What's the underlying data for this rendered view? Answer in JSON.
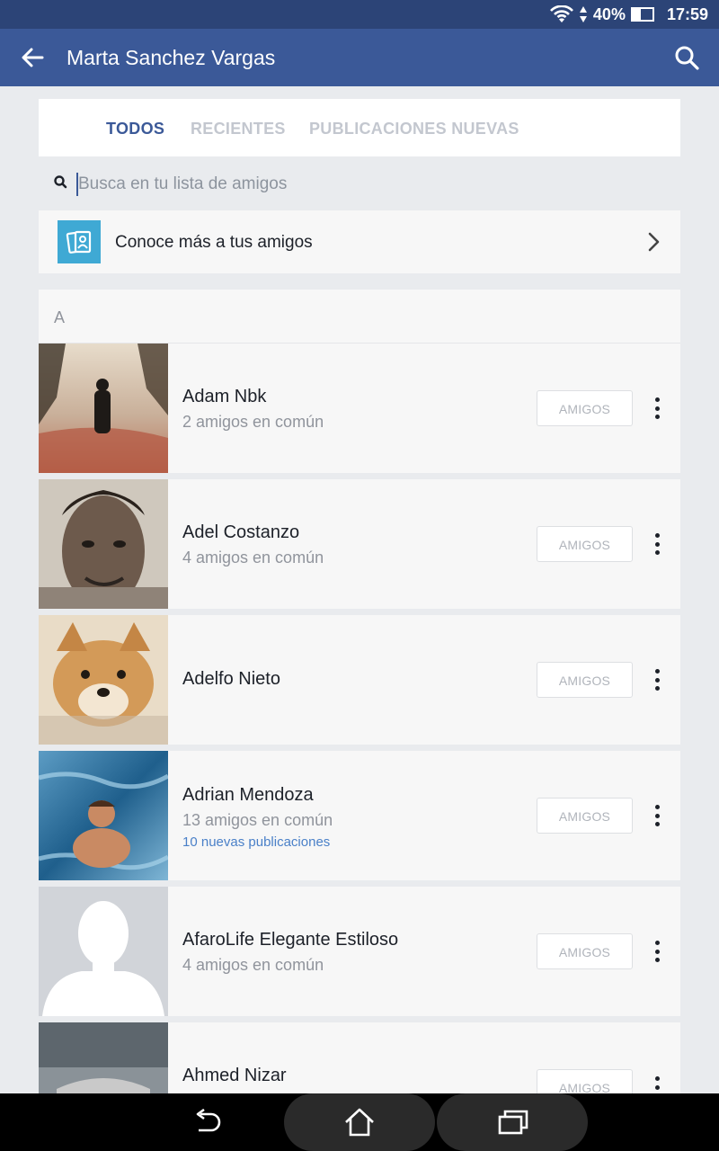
{
  "status_bar": {
    "battery_percent": "40%",
    "time": "17:59",
    "icons": [
      "wifi-icon",
      "data-arrows-icon",
      "battery-icon"
    ]
  },
  "app_bar": {
    "title": "Marta Sanchez Vargas",
    "icons": [
      "back-arrow-icon",
      "search-icon"
    ]
  },
  "tabs": [
    {
      "label": "TODOS",
      "active": true
    },
    {
      "label": "RECIENTES",
      "active": false
    },
    {
      "label": "PUBLICACIONES NUEVAS",
      "active": false
    }
  ],
  "search": {
    "placeholder": "Busca en tu lista de amigos",
    "value": ""
  },
  "discover": {
    "label": "Conoce más a tus amigos",
    "icon": "friends-cards-icon"
  },
  "section": {
    "letter": "A"
  },
  "friends": [
    {
      "name": "Adam Nbk",
      "mutual": "2 amigos en común",
      "news": "",
      "button": "AMIGOS"
    },
    {
      "name": "Adel Costanzo",
      "mutual": "4 amigos en común",
      "news": "",
      "button": "AMIGOS"
    },
    {
      "name": "Adelfo Nieto",
      "mutual": "",
      "news": "",
      "button": "AMIGOS"
    },
    {
      "name": "Adrian Mendoza",
      "mutual": "13 amigos en común",
      "news": "10 nuevas publicaciones",
      "button": "AMIGOS"
    },
    {
      "name": "AfaroLife Elegante Estiloso",
      "mutual": "4 amigos en común",
      "news": "",
      "button": "AMIGOS"
    },
    {
      "name": "Ahmed Nizar",
      "mutual": "",
      "news": "",
      "button": "AMIGOS"
    }
  ],
  "colors": {
    "status_bar": "#2c4477",
    "app_bar": "#3b5998",
    "active_tab": "#3b5998",
    "link": "#4a80c8"
  },
  "nav_bar": {
    "icons": [
      "back-nav-icon",
      "home-nav-icon",
      "recents-nav-icon"
    ]
  }
}
